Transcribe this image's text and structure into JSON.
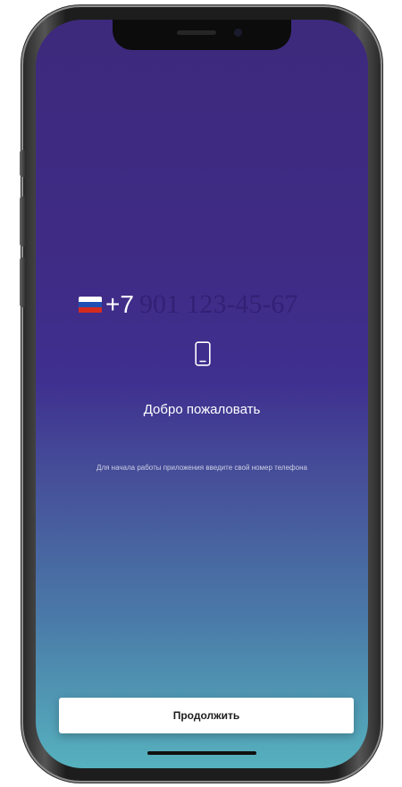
{
  "phone_entry": {
    "country_flag": {
      "name": "russia-flag-icon",
      "colors": [
        "#ffffff",
        "#1f4fb5",
        "#d52b1e"
      ]
    },
    "country_code": "+7",
    "placeholder": "901 123-45-67"
  },
  "icon": {
    "name": "smartphone-icon"
  },
  "welcome_title": "Добро пожаловать",
  "subtitle": "Для начала работы приложения введите свой номер телефона",
  "continue_button_label": "Продолжить",
  "colors": {
    "gradient_top": "#3d2a7c",
    "gradient_mid": "#3f2f8f",
    "gradient_bottom": "#56b1be",
    "button_bg": "#ffffff",
    "text": "#ffffff"
  }
}
